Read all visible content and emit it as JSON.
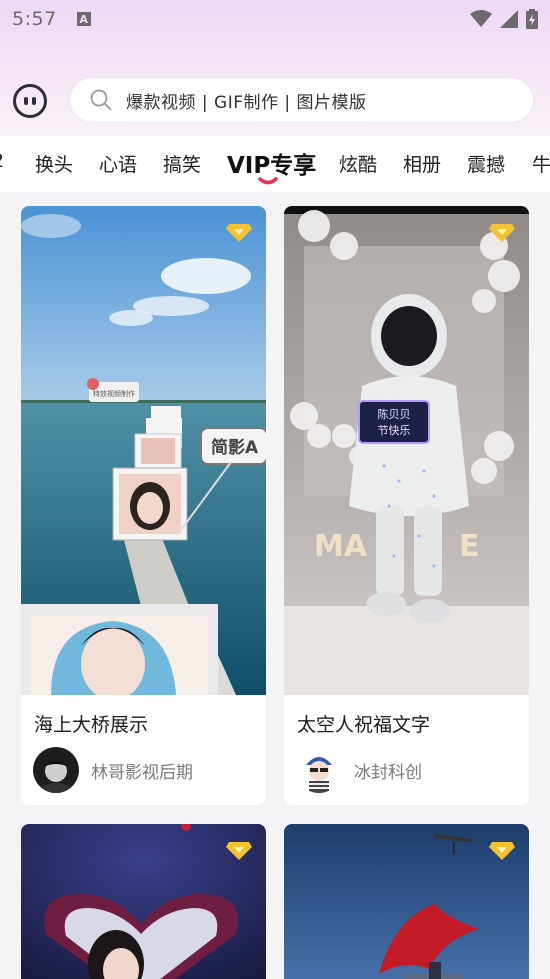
{
  "status": {
    "time": "5:57",
    "notif_letter": "A"
  },
  "search": {
    "text": "爆款视频 | GIF制作 | 图片模版"
  },
  "tabs": {
    "left_edge": "2",
    "items": [
      "换头",
      "心语",
      "搞笑",
      "VIP专享",
      "炫酷",
      "相册",
      "震撼"
    ],
    "active": "VIP专享",
    "right_edge": "牛"
  },
  "cards": [
    {
      "title": "海上大桥展示",
      "author": "林哥影视后期",
      "overlay_text": "简影A",
      "sign_text": "特效视频制作"
    },
    {
      "title": "太空人祝福文字",
      "author": "冰封科创",
      "sign_line1": "陈贝贝",
      "sign_line2": "节快乐"
    },
    {
      "title": "",
      "author": ""
    },
    {
      "title": "",
      "author": ""
    }
  ],
  "colors": {
    "accent": "#e8344e",
    "vip_gold": "#f2c230"
  }
}
